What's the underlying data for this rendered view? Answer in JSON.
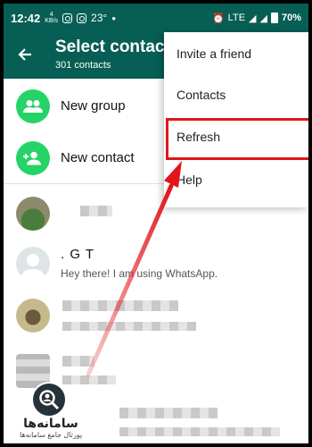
{
  "status_bar": {
    "time": "12:42",
    "data_speed_top": "4",
    "data_speed_bottom": "KB/s",
    "temperature": "23°",
    "network": "LTE",
    "battery": "70%"
  },
  "app_bar": {
    "title": "Select contact",
    "subtitle": "301 contacts"
  },
  "actions": {
    "new_group": "New group",
    "new_contact": "New contact"
  },
  "contacts": [
    {
      "name": "",
      "status": ""
    },
    {
      "name": ". G T",
      "status": "Hey there! I am using WhatsApp."
    },
    {
      "name": "",
      "status": ""
    },
    {
      "name": "",
      "status": ""
    }
  ],
  "menu": {
    "items": [
      "Invite a friend",
      "Contacts",
      "Refresh",
      "Help"
    ],
    "highlighted": "Refresh"
  },
  "watermark": {
    "title": "سامانه‌ها",
    "subtitle": "پورتال جامع سامانه‌ها"
  },
  "colors": {
    "header": "#075e54",
    "accent": "#25d366",
    "highlight": "#e0161b"
  }
}
